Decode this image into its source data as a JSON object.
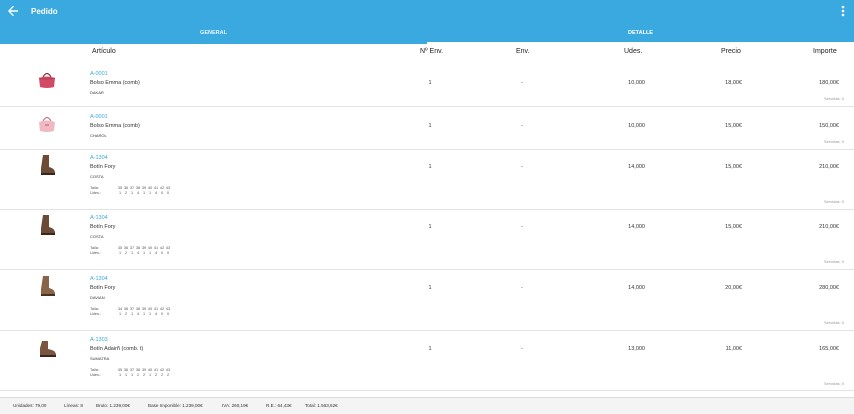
{
  "appbar": {
    "title": "Pedido",
    "back_icon": "arrow-left-icon",
    "menu_icon": "more-vert-icon",
    "color": "#3aa9e0"
  },
  "tabs": [
    {
      "label": "GENERAL",
      "active": false
    },
    {
      "label": "DETALLE",
      "active": true
    }
  ],
  "columns": {
    "articulo": "Artículo",
    "nenv": "Nº Env.",
    "env": "Env.",
    "udes": "Udes.",
    "precio": "Precio",
    "importe": "Importe"
  },
  "rows": [
    {
      "code": "A-0001",
      "name": "Bolso Emma (comb)",
      "color": "DAKAR",
      "nenv": "1",
      "env": "-",
      "udes": "10,000",
      "precio": "18,00€",
      "importe": "180,00€",
      "servidas": "Servidas: 0",
      "image": "pink-handbag"
    },
    {
      "code": "A-0001",
      "name": "Bolso Emma (comb)",
      "color": "CHAROL",
      "nenv": "1",
      "env": "-",
      "udes": "10,000",
      "precio": "15,00€",
      "importe": "150,00€",
      "servidas": "Servidas: 0",
      "image": "light-pink-handbag"
    },
    {
      "code": "A-1304",
      "name": "Botín Fory",
      "color": "COSTA",
      "nenv": "1",
      "env": "-",
      "udes": "14,000",
      "precio": "15,00€",
      "importe": "210,00€",
      "servidas": "Servidas: 0",
      "image": "brown-boot",
      "talla_label": "Talla:",
      "udes_label": "Udes.:",
      "tallas": [
        "35",
        "36",
        "37",
        "38",
        "39",
        "40",
        "41",
        "42",
        "43"
      ],
      "udes_talla": [
        "1",
        "2",
        "1",
        "4",
        "1",
        "1",
        "4",
        "0",
        "0"
      ]
    },
    {
      "code": "A-1304",
      "name": "Botín Fory",
      "color": "COSTA",
      "nenv": "1",
      "env": "-",
      "udes": "14,000",
      "precio": "15,00€",
      "importe": "210,00€",
      "servidas": "Servidas: 0",
      "image": "brown-boot",
      "talla_label": "Talla:",
      "udes_label": "Udes.:",
      "tallas": [
        "35",
        "36",
        "37",
        "38",
        "39",
        "40",
        "41",
        "42",
        "43"
      ],
      "udes_talla": [
        "1",
        "2",
        "1",
        "4",
        "1",
        "1",
        "4",
        "0",
        "0"
      ]
    },
    {
      "code": "A-1304",
      "name": "Botín Fory",
      "color": "DAVIAN",
      "nenv": "1",
      "env": "-",
      "udes": "14,000",
      "precio": "20,00€",
      "importe": "280,00€",
      "servidas": "Servidas: 0",
      "image": "brown-boot",
      "talla_label": "Talla:",
      "udes_label": "Udes.:",
      "tallas": [
        "34",
        "36",
        "37",
        "38",
        "39",
        "40",
        "41",
        "42",
        "43"
      ],
      "udes_talla": [
        "1",
        "2",
        "1",
        "4",
        "1",
        "1",
        "4",
        "0",
        "0"
      ]
    },
    {
      "code": "A-1303",
      "name": "Botín Adairñ (comb. t)",
      "color": "SUMATRA",
      "nenv": "1",
      "env": "-",
      "udes": "13,000",
      "precio": "11,00€",
      "importe": "165,00€",
      "servidas": "Servidas: 0",
      "image": "brown-ankle-boot",
      "talla_label": "Talla:",
      "udes_label": "Udes.:",
      "tallas": [
        "35",
        "36",
        "37",
        "38",
        "39",
        "40",
        "41",
        "42",
        "43"
      ],
      "udes_talla": [
        "1",
        "1",
        "1",
        "2",
        "2",
        "1",
        "2",
        "2",
        "2"
      ]
    }
  ],
  "footer": {
    "unidades": "Unidades: 79,00",
    "lineas": "Líneas: 8",
    "bruto": "Bruto: 1.239,00€",
    "base": "Base Imponible: 1.239,00€",
    "iva": "IVA: 260,19€",
    "re": "R.E.: 64,43€",
    "total": "Total: 1.563,62€"
  }
}
